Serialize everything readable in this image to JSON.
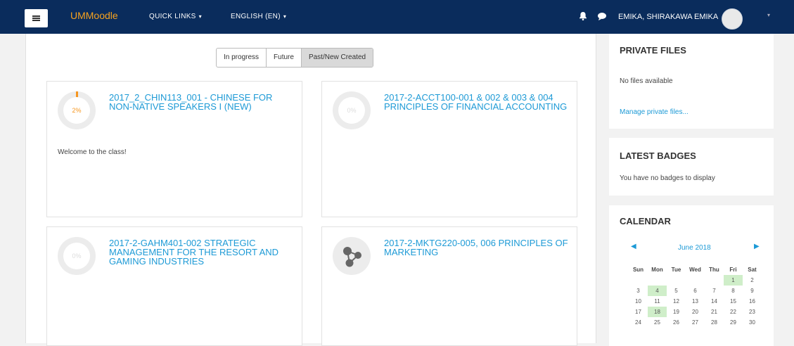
{
  "nav": {
    "brand": "UMMoodle",
    "quick_links": "QUICK LINKS",
    "language": "ENGLISH (EN)",
    "caret": "▾",
    "user": "EMIKA, SHIRAKAWA EMIKA"
  },
  "tabs": [
    "In progress",
    "Future",
    "Past/New Created"
  ],
  "courses": [
    {
      "progress": "2%",
      "title": "2017_2_CHIN113_001 - CHINESE FOR NON-NATIVE SPEAKERS I (NEW)",
      "summary": "Welcome to the class!"
    },
    {
      "progress": "0%",
      "title": "2017-2-ACCT100-001 & 002 & 003 & 004 PRINCIPLES OF FINANCIAL ACCOUNTING",
      "summary": ""
    },
    {
      "progress": "0%",
      "title": "2017-2-GAHM401-002 STRATEGIC MANAGEMENT FOR THE RESORT AND GAMING INDUSTRIES",
      "summary": ""
    },
    {
      "progress": "",
      "title": "2017-2-MKTG220-005, 006 PRINCIPLES OF MARKETING",
      "summary": ""
    }
  ],
  "private_files": {
    "title": "PRIVATE FILES",
    "empty": "No files available",
    "link": "Manage private files..."
  },
  "badges": {
    "title": "LATEST BADGES",
    "empty": "You have no badges to display"
  },
  "calendar": {
    "title": "CALENDAR",
    "month": "June 2018",
    "prev": "◀",
    "next": "▶",
    "weekdays": [
      "Sun",
      "Mon",
      "Tue",
      "Wed",
      "Thu",
      "Fri",
      "Sat"
    ],
    "days": [
      "",
      "",
      "",
      "",
      "",
      "1",
      "2",
      "3",
      "4",
      "5",
      "6",
      "7",
      "8",
      "9",
      "10",
      "11",
      "12",
      "13",
      "14",
      "15",
      "16",
      "17",
      "18",
      "19",
      "20",
      "21",
      "22",
      "23",
      "24",
      "25",
      "26",
      "27",
      "28",
      "29",
      "30"
    ],
    "highlighted": [
      "1",
      "4",
      "18"
    ]
  }
}
